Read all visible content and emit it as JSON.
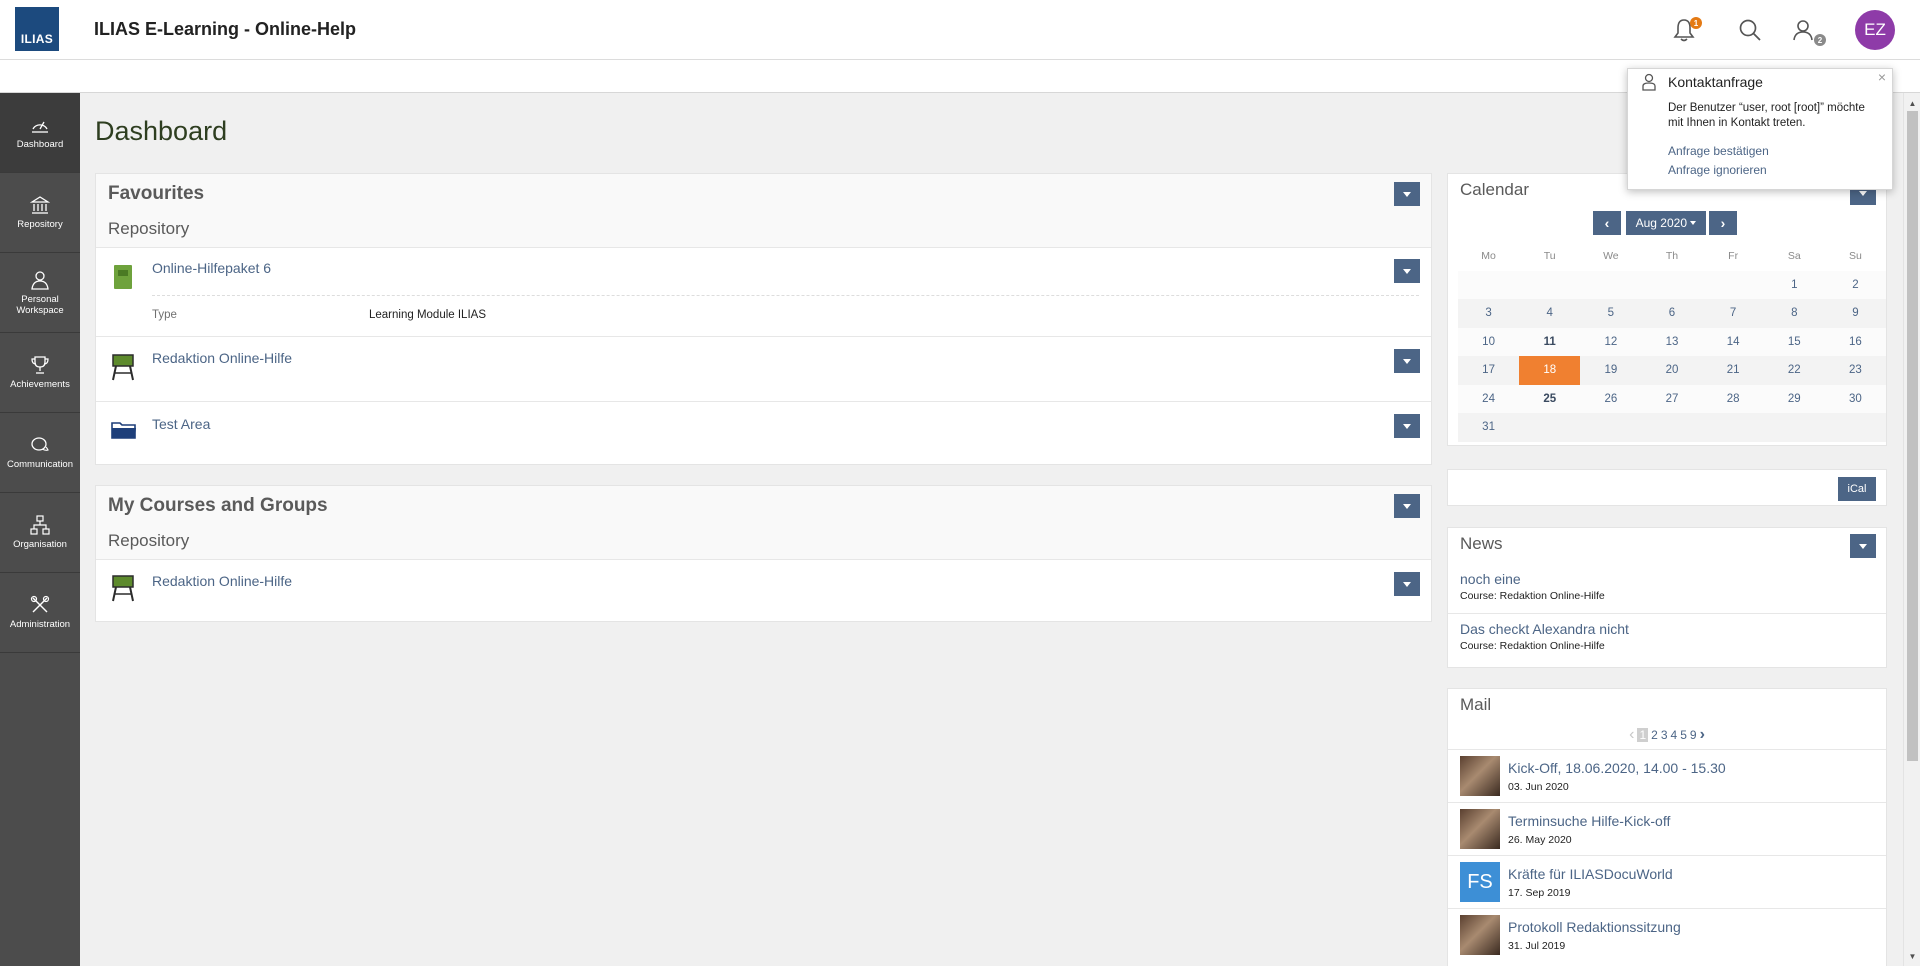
{
  "header": {
    "logo_text": "ILIAS",
    "title": "ILIAS E-Learning - Online-Help",
    "notification_count": "1",
    "contacts_count": "2",
    "avatar_initials": "EZ"
  },
  "sidebar": {
    "items": [
      {
        "label": "Dashboard",
        "icon": "dashboard-icon"
      },
      {
        "label": "Repository",
        "icon": "repository-icon"
      },
      {
        "label": "Personal Workspace",
        "icon": "personal-workspace-icon"
      },
      {
        "label": "Achievements",
        "icon": "trophy-icon"
      },
      {
        "label": "Communication",
        "icon": "communication-icon"
      },
      {
        "label": "Organisation",
        "icon": "organisation-icon"
      },
      {
        "label": "Administration",
        "icon": "administration-icon"
      }
    ]
  },
  "page_title": "Dashboard",
  "favourites": {
    "title": "Favourites",
    "group": "Repository",
    "items": [
      {
        "title": "Online-Hilfepaket 6",
        "prop_label": "Type",
        "prop_value": "Learning Module ILIAS"
      },
      {
        "title": "Redaktion Online-Hilfe"
      },
      {
        "title": "Test Area"
      }
    ]
  },
  "courses": {
    "title": "My Courses and Groups",
    "group": "Repository",
    "items": [
      {
        "title": "Redaktion Online-Hilfe"
      }
    ]
  },
  "calendar": {
    "title": "Calendar",
    "month": "Aug 2020",
    "weekdays": [
      "Mo",
      "Tu",
      "We",
      "Th",
      "Fr",
      "Sa",
      "Su"
    ],
    "weeks": [
      [
        "",
        "",
        "",
        "",
        "",
        "1",
        "2"
      ],
      [
        "3",
        "4",
        "5",
        "6",
        "7",
        "8",
        "9"
      ],
      [
        "10",
        "11",
        "12",
        "13",
        "14",
        "15",
        "16"
      ],
      [
        "17",
        "18",
        "19",
        "20",
        "21",
        "22",
        "23"
      ],
      [
        "24",
        "25",
        "26",
        "27",
        "28",
        "29",
        "30"
      ],
      [
        "31",
        "",
        "",
        "",
        "",
        "",
        ""
      ]
    ],
    "today": "18",
    "bold_days": [
      "11",
      "25"
    ],
    "ical_label": "iCal"
  },
  "news": {
    "title": "News",
    "items": [
      {
        "title": "noch eine",
        "meta": "Course: Redaktion Online-Hilfe"
      },
      {
        "title": "Das checkt Alexandra nicht",
        "meta": "Course: Redaktion Online-Hilfe"
      }
    ]
  },
  "mail": {
    "title": "Mail",
    "pages": [
      "1",
      "2",
      "3",
      "4",
      "5",
      "9"
    ],
    "current_page": "1",
    "items": [
      {
        "title": "Kick-Off, 18.06.2020, 14.00 - 15.30",
        "date": "03. Jun 2020",
        "avatar": "photo"
      },
      {
        "title": "Terminsuche Hilfe-Kick-off",
        "date": "26. May 2020",
        "avatar": "photo"
      },
      {
        "title": "Kräfte für ILIASDocuWorld",
        "date": "17. Sep 2019",
        "avatar": "FS"
      },
      {
        "title": "Protokoll Redaktionssitzung",
        "date": "31. Jul 2019",
        "avatar": "photo"
      }
    ]
  },
  "popover": {
    "title": "Kontaktanfrage",
    "text": "Der Benutzer “user, root [root]” möchte mit Ihnen in Kontakt treten.",
    "confirm": "Anfrage bestätigen",
    "ignore": "Anfrage ignorieren",
    "close": "×"
  },
  "colors": {
    "accent": "#4c6586",
    "today": "#f08030",
    "avatar": "#8e3ba8",
    "sidebar": "#4c4c4c",
    "logo": "#1c4a7e"
  }
}
